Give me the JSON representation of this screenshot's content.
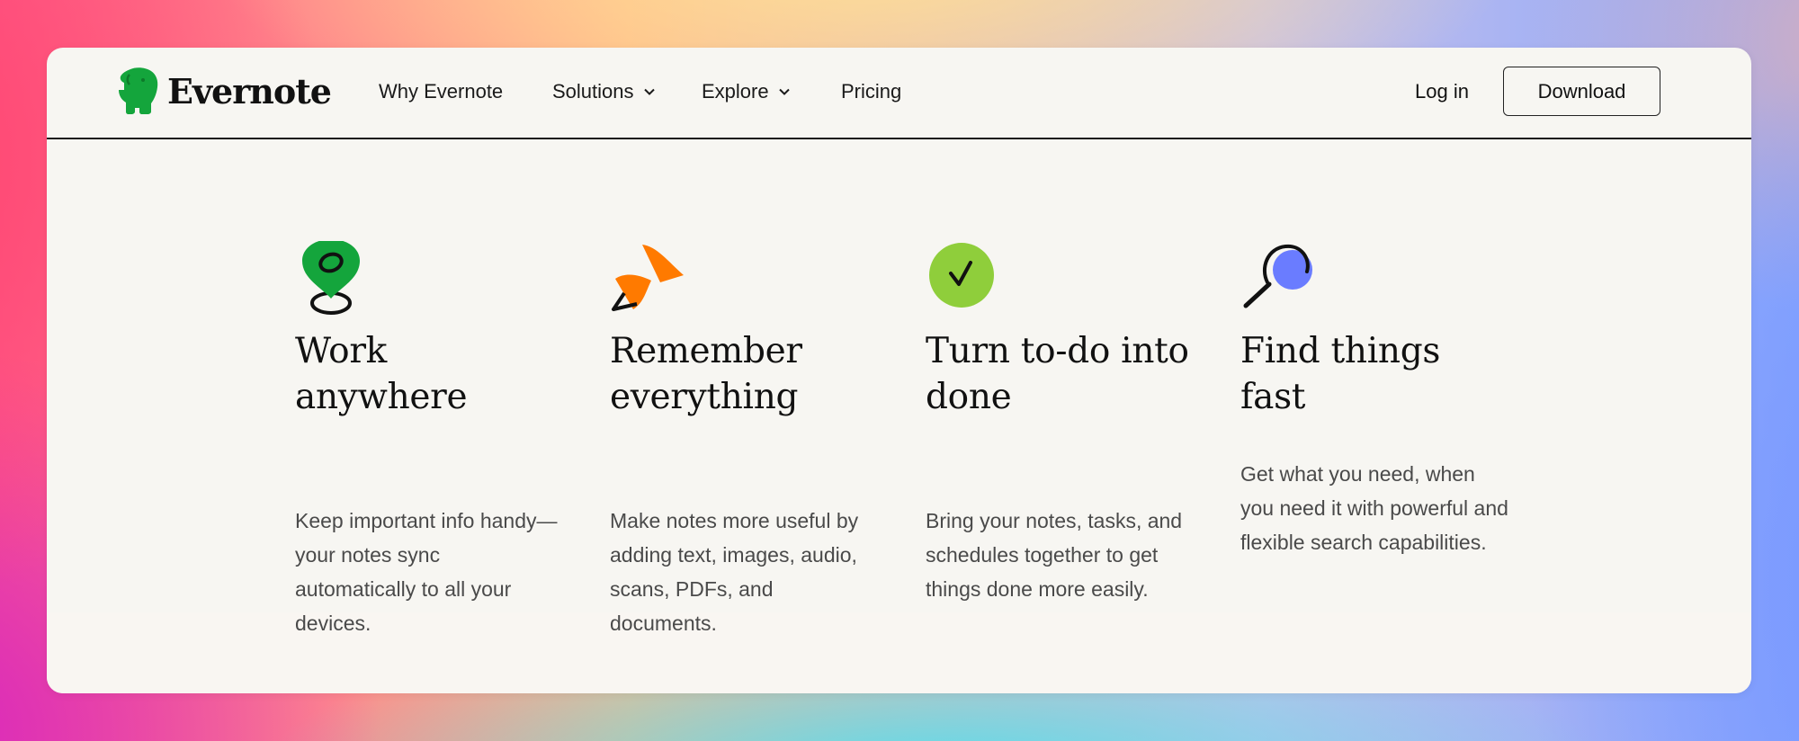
{
  "nav": {
    "brand": "Evernote",
    "links": [
      "Why Evernote",
      "Solutions",
      "Explore",
      "Pricing"
    ],
    "login": "Log in",
    "download": "Download"
  },
  "features": [
    {
      "icon": "location-pin-icon",
      "title": "Work anywhere",
      "text": "Keep important info handy—your notes sync automatically to all your devices."
    },
    {
      "icon": "push-pin-icon",
      "title": "Remember everything",
      "text": "Make notes more useful by adding text, images, audio, scans, PDFs, and documents."
    },
    {
      "icon": "checkmark-icon",
      "title": "Turn to-do into done",
      "text": "Bring your notes, tasks, and schedules together to get things done more easily."
    },
    {
      "icon": "magnifier-icon",
      "title": "Find things fast",
      "text": "Get what you need, when you need it with powerful and flexible search capabilities."
    }
  ],
  "colors": {
    "brand_green": "#14a53c",
    "orange": "#ff7a00",
    "lime": "#8fce3b",
    "blue": "#6a7cff"
  }
}
